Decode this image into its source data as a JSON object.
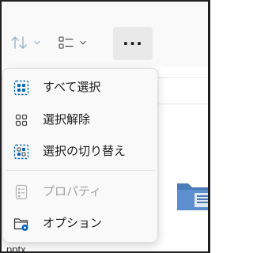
{
  "toolbar": {
    "sort_icon": "sort-arrows-icon",
    "view_icon": "list-view-icon",
    "more_label": "···"
  },
  "menu": {
    "select_all": "すべて選択",
    "select_none": "選択解除",
    "invert_selection": "選択の切り替え",
    "properties": "プロパティ",
    "options": "オプション"
  },
  "background": {
    "partial_filename": "pptx"
  },
  "colors": {
    "accent": "#0067c0",
    "hover": "#e9e9e9",
    "disabled_text": "#a0a0a0"
  }
}
